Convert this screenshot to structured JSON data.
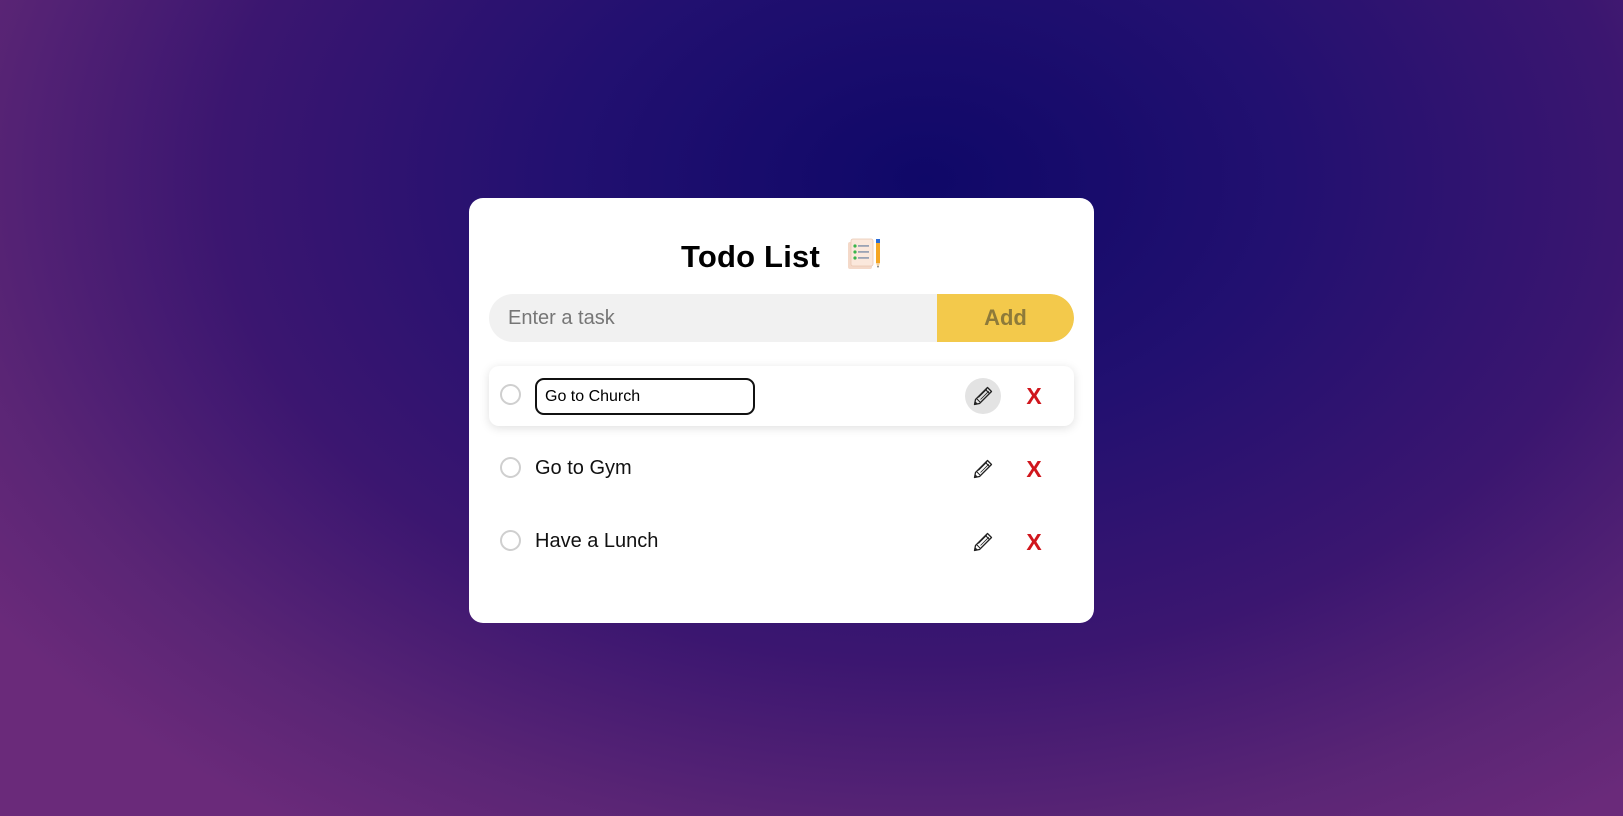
{
  "app": {
    "title": "Todo List",
    "title_icon": "notepad-checklist-icon"
  },
  "form": {
    "placeholder": "Enter a task",
    "input_value": "",
    "add_label": "Add"
  },
  "todos": [
    {
      "text": "Go to Church",
      "completed": false,
      "editing": true,
      "edit_icon": "pencil-icon",
      "delete_label": "X"
    },
    {
      "text": "Go to Gym",
      "completed": false,
      "editing": false,
      "edit_icon": "pencil-icon",
      "delete_label": "X"
    },
    {
      "text": "Have a Lunch",
      "completed": false,
      "editing": false,
      "edit_icon": "pencil-icon",
      "delete_label": "X"
    }
  ],
  "colors": {
    "accent": "#f3c94b",
    "delete": "#d0161d",
    "background_center": "#0f0868",
    "background_edge": "#6a2a7a"
  }
}
